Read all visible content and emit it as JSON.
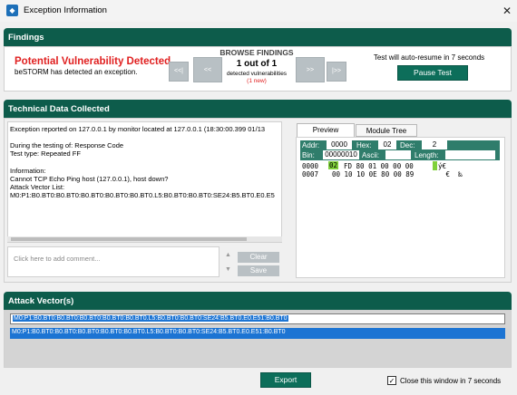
{
  "window": {
    "title": "Exception Information",
    "close_glyph": "✕",
    "icon": "shield-icon"
  },
  "findings": {
    "header": "Findings",
    "headline": "Potential Vulnerability Detected",
    "subtext": "beSTORM has detected an exception.",
    "browse_label": "BROWSE FINDINGS",
    "count": "1 out of 1",
    "detected_label": "detected vulnerabilities",
    "new_label": "(1 new)",
    "nav": {
      "first": "<<|",
      "prev": "<<",
      "next": ">>",
      "last": "|>>"
    },
    "resume_text": "Test will auto-resume in 7 seconds",
    "pause_button": "Pause Test"
  },
  "technical": {
    "header": "Technical Data Collected",
    "log_lines": [
      "Exception reported on 127.0.0.1 by monitor located at 127.0.0.1 (18:30:00.399 01/13",
      "",
      "During the testing of: Response Code",
      "Test type: Repeated FF",
      "",
      "Information:",
      "Cannot TCP Echo Ping host (127.0.0.1), host down?",
      "Attack Vector List:",
      "M0:P1:B0.BT0:B0.BT0:B0.BT0:B0.BT0:B0.BT0.L5:B0.BT0:B0.BT0:SE24:B5.BT0.E0.E5"
    ],
    "comment_placeholder": "Click here to add comment...",
    "clear_button": "Clear",
    "save_button": "Save",
    "tabs": {
      "preview": "Preview",
      "module_tree": "Module Tree"
    },
    "hex": {
      "addr_label": "Addr:",
      "addr_value": "0000",
      "hex_label": "Hex:",
      "hex_value": "02",
      "dec_label": "Dec:",
      "dec_value": "2",
      "bin_label": "Bin:",
      "bin_value": "00000010",
      "ascii_label": "Ascii:",
      "ascii_value": "",
      "length_label": "Length:",
      "length_value": "",
      "row1_addr": "0000",
      "row1_sel": "02",
      "row1_bytes": "FD 80 01 00 00 00",
      "row1_ascii_sel": " ",
      "row1_ascii": "ý€",
      "row2_addr": "0007",
      "row2_bytes": "00 10 10 0E 80 00 89",
      "row2_ascii": "   €  ‰"
    }
  },
  "attack": {
    "header": "Attack Vector(s)",
    "input_value": "M0:P1:B0.BT0:B0.BT0:B0.BT0:B0.BT0:B0.BT0.L5:B0.BT0:B0.BT0:SE24:B5.BT0.E0.E51:B0.BT0",
    "rows": [
      "M0:P1:B0.BT0:B0.BT0:B0.BT0:B0.BT0:B0.BT0.L5:B0.BT0:B0.BT0:SE24:B5.BT0.E0.E51:B0.BT0"
    ]
  },
  "footer": {
    "export_button": "Export",
    "close_checkbox_label": "Close this window in 7 seconds",
    "check_glyph": "✓"
  }
}
